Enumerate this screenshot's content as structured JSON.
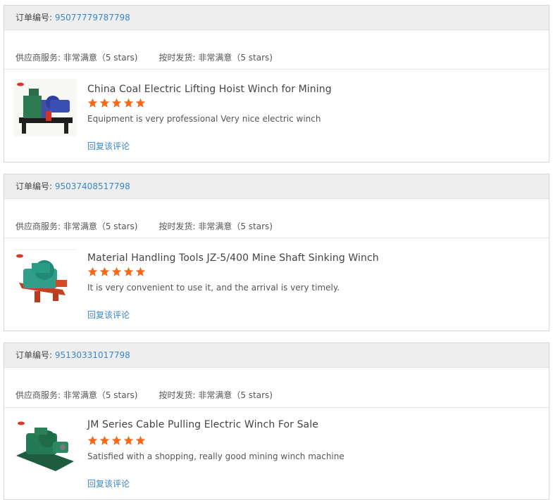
{
  "orders": [
    {
      "order_label": "订单编号:",
      "order_number": "95077779787798",
      "service_text": "供应商服务: 非常满意（5 stars)",
      "shipping_text": "按时发货: 非常满意（5 stars)",
      "product_title": "China Coal Electric Lifting Hoist Winch for Mining",
      "rating": 5,
      "review": "Equipment is very professional  Very nice  electric winch",
      "reply_label": "回复该评论"
    },
    {
      "order_label": "订单编号:",
      "order_number": "95037408517798",
      "service_text": "供应商服务: 非常满意（5 stars)",
      "shipping_text": "按时发货: 非常满意（5 stars)",
      "product_title": "Material Handling Tools JZ-5/400 Mine Shaft Sinking Winch",
      "rating": 5,
      "review": "It is very convenient to use it, and the arrival is very timely.",
      "reply_label": "回复该评论"
    },
    {
      "order_label": "订单编号:",
      "order_number": "95130331017798",
      "service_text": "供应商服务: 非常满意（5 stars)",
      "shipping_text": "按时发货: 非常满意（5 stars)",
      "product_title": "JM Series Cable Pulling Electric Winch For Sale",
      "rating": 5,
      "review": "Satisfied with a shopping, really good  mining winch machine",
      "reply_label": "回复该评论"
    }
  ],
  "colors": {
    "star": "#f26b1d",
    "link": "#3b86c8",
    "header_bg": "#eeeeee"
  }
}
